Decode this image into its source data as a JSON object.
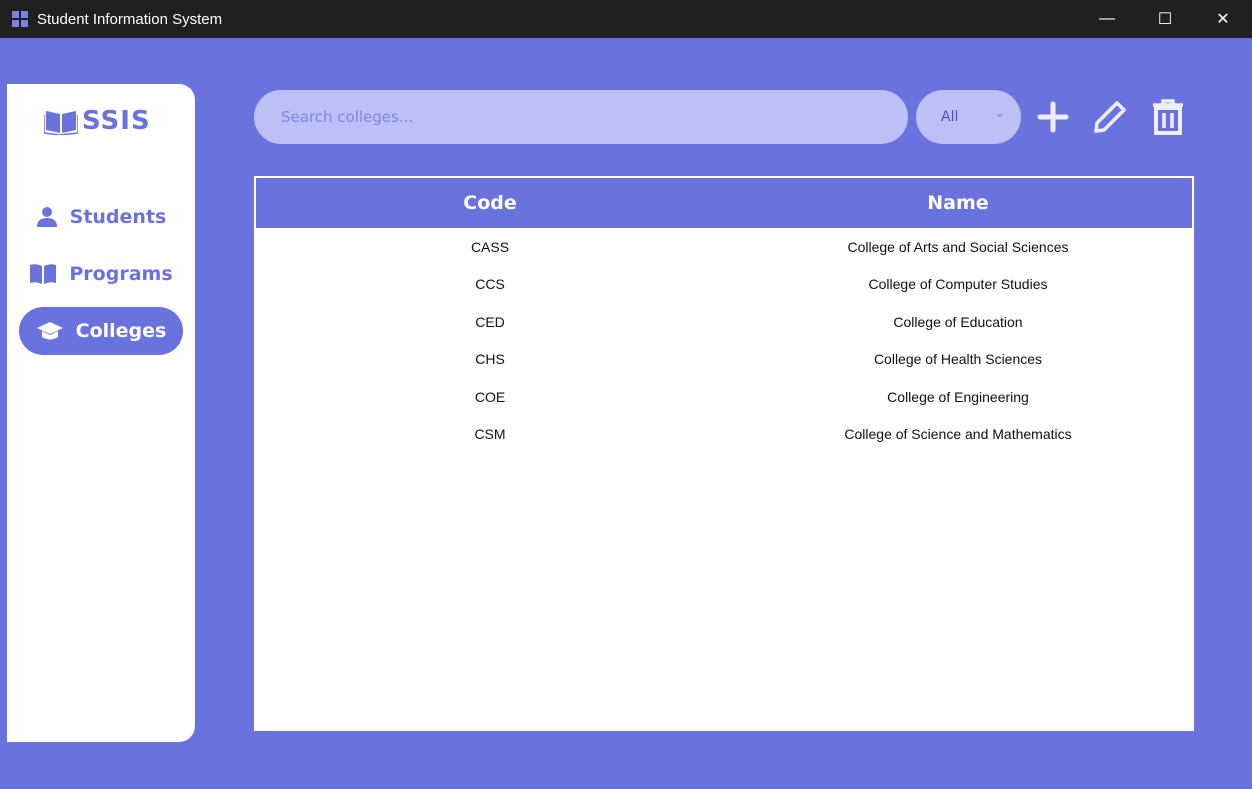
{
  "window": {
    "title": "Student Information System",
    "minimize": "—",
    "maximize": "☐",
    "close": "✕"
  },
  "sidebar": {
    "logo": "SSIS",
    "items": [
      {
        "label": "Students",
        "icon": "user-icon"
      },
      {
        "label": "Programs",
        "icon": "book-icon"
      },
      {
        "label": "Colleges",
        "icon": "graduation-cap-icon",
        "active": true
      }
    ]
  },
  "toolbar": {
    "search_placeholder": "Search colleges...",
    "filter_value": "All"
  },
  "table": {
    "headers": [
      "Code",
      "Name"
    ],
    "rows": [
      [
        "CASS",
        "College of Arts and Social Sciences"
      ],
      [
        "CCS",
        "College of Computer Studies"
      ],
      [
        "CED",
        "College of Education"
      ],
      [
        "CHS",
        "College of Health Sciences"
      ],
      [
        "COE",
        "College of Engineering"
      ],
      [
        "CSM",
        "College of Science and Mathematics"
      ]
    ]
  }
}
